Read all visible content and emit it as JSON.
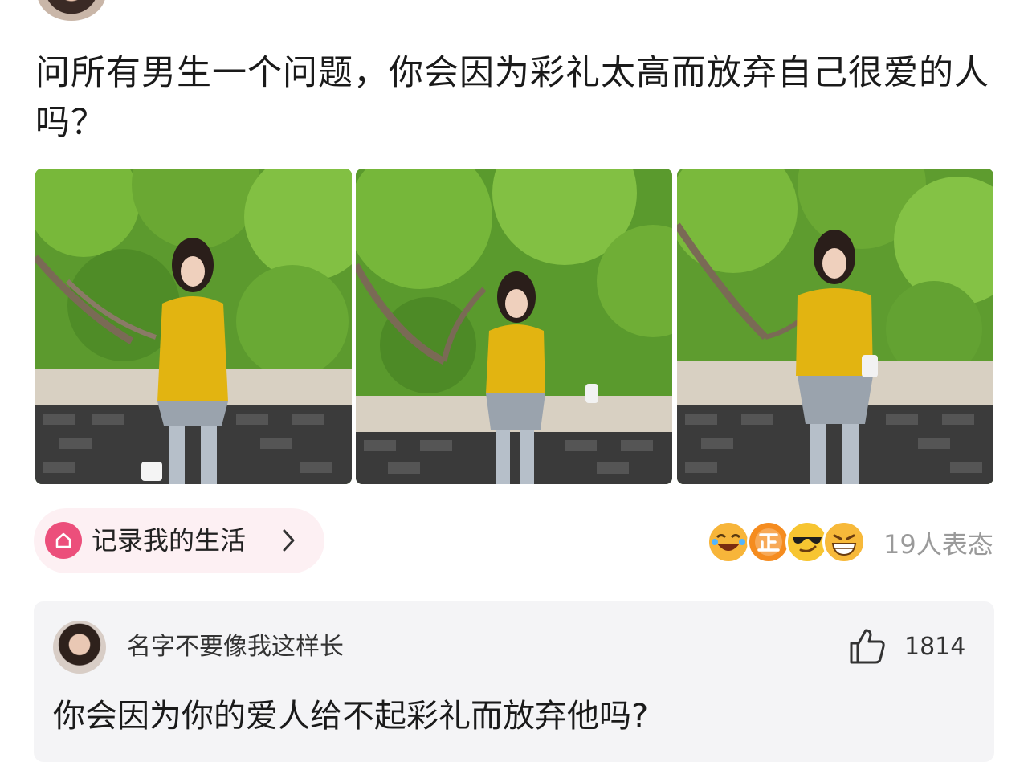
{
  "post": {
    "title": "问所有男生一个问题，你会因为彩礼太高而放弃自己很爱的人吗？",
    "photos": [
      {
        "name": "photo-1"
      },
      {
        "name": "photo-2"
      },
      {
        "name": "photo-3"
      }
    ]
  },
  "topic": {
    "label": "记录我的生活",
    "icon": "home-icon",
    "accent": "#ec4f7b",
    "chevron": "chevron-right-icon"
  },
  "reactions": {
    "icons": [
      "laughing-face-icon",
      "zheng-badge-icon",
      "sunglasses-face-icon",
      "grinning-face-icon"
    ],
    "count_text": "19人表态"
  },
  "comment": {
    "username": "名字不要像我这样长",
    "likes": "1814",
    "text": "你会因为你的爱人给不起彩礼而放弃他吗?",
    "like_icon": "thumbs-up-icon"
  },
  "colors": {
    "background": "#ffffff",
    "comment_bg": "#f4f4f6",
    "pill_bg": "#fdf0f3",
    "muted_text": "#9a9a9a"
  }
}
